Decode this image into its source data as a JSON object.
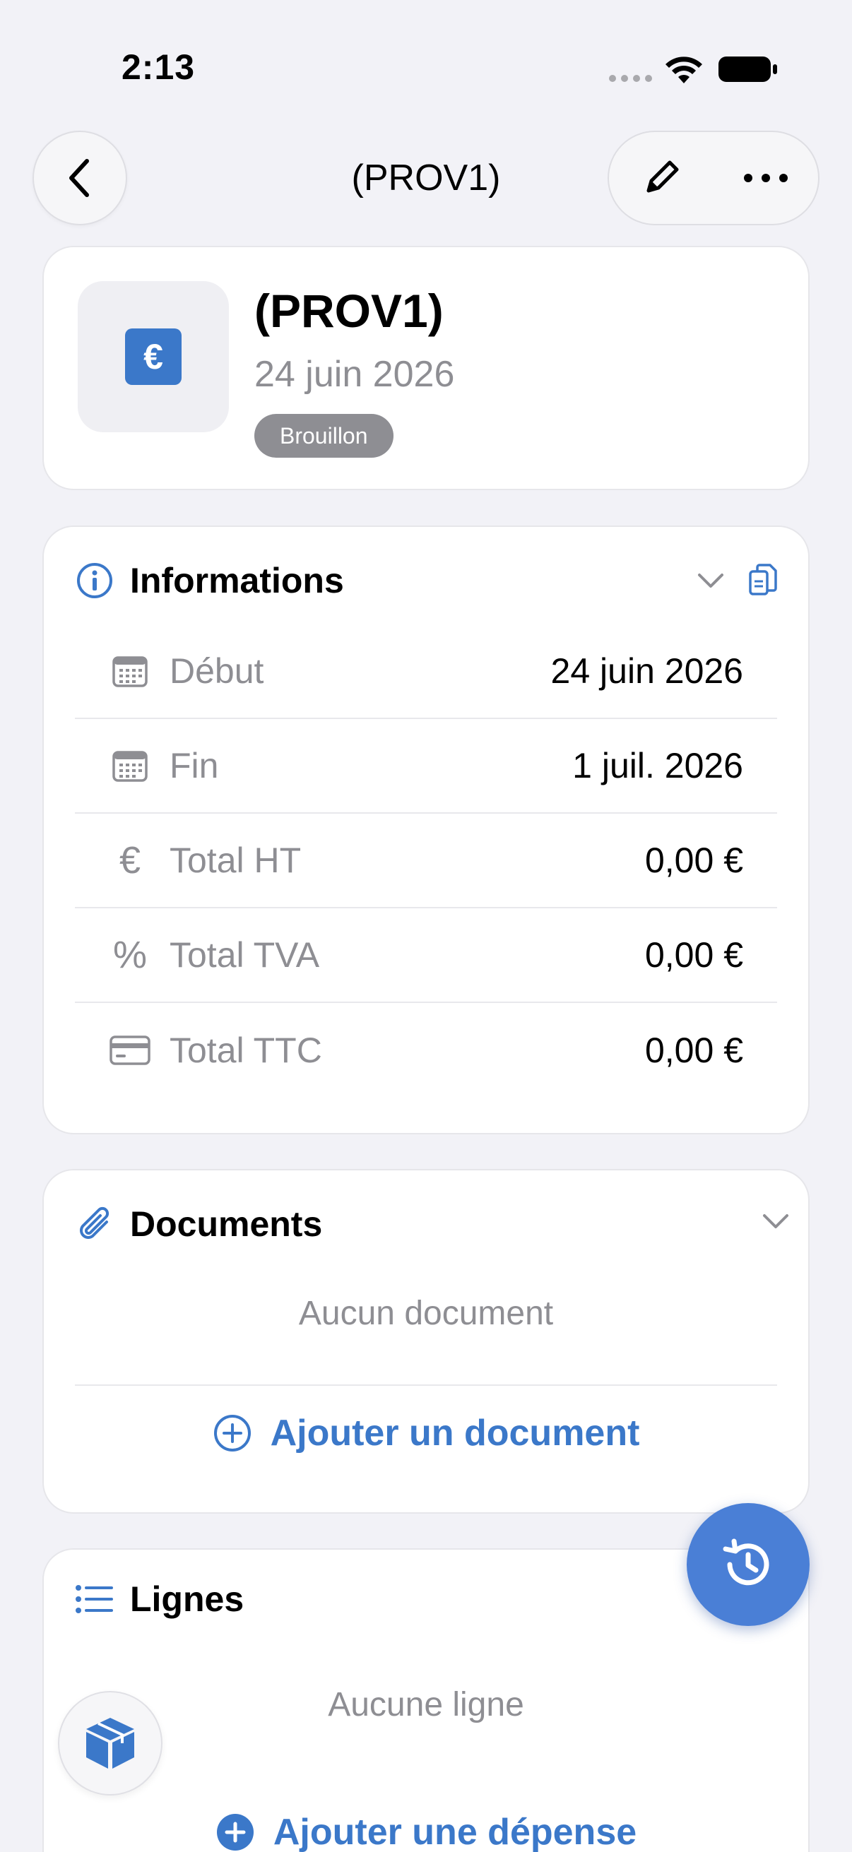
{
  "status_bar": {
    "time": "2:13"
  },
  "nav": {
    "title": "(PROV1)"
  },
  "header": {
    "title": "(PROV1)",
    "date": "24 juin 2026",
    "badge": "Brouillon",
    "icon_glyph": "€"
  },
  "informations": {
    "title": "Informations",
    "rows": [
      {
        "icon": "calendar-icon",
        "label": "Début",
        "value": "24 juin 2026"
      },
      {
        "icon": "calendar-icon",
        "label": "Fin",
        "value": "1 juil. 2026"
      },
      {
        "icon": "euro-icon",
        "label": "Total HT",
        "value": "0,00 €"
      },
      {
        "icon": "percent-icon",
        "label": "Total TVA",
        "value": "0,00 €"
      },
      {
        "icon": "credit-card-icon",
        "label": "Total TTC",
        "value": "0,00 €"
      }
    ],
    "euro_glyph": "€",
    "percent_glyph": "%"
  },
  "documents": {
    "title": "Documents",
    "empty_text": "Aucun document",
    "add_label": "Ajouter un document"
  },
  "lignes": {
    "title": "Lignes",
    "empty_text": "Aucune ligne",
    "add_label": "Ajouter une dépense"
  },
  "colors": {
    "accent": "#3b78c9",
    "fab": "#4a7fd6",
    "badge": "#8e8e93",
    "background": "#f2f2f7"
  }
}
